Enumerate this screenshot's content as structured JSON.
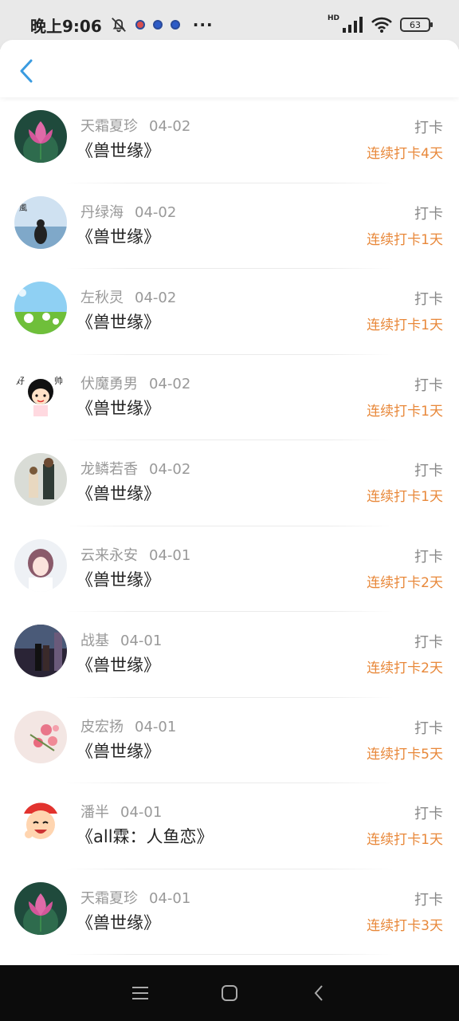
{
  "status_bar": {
    "time": "晚上9:06",
    "more": "···",
    "hd": "HD",
    "battery": "63"
  },
  "header": {
    "back_icon": "chevron-left-icon",
    "accent_color": "#3a9be0"
  },
  "items": [
    {
      "user": "天霜夏珍",
      "date": "04-02",
      "book": "《兽世缘》",
      "action": "打卡",
      "streak": "连续打卡4天",
      "avatar": "lotus"
    },
    {
      "user": "丹绿海",
      "date": "04-02",
      "book": "《兽世缘》",
      "action": "打卡",
      "streak": "连续打卡1天",
      "avatar": "sea-girl"
    },
    {
      "user": "左秋灵",
      "date": "04-02",
      "book": "《兽世缘》",
      "action": "打卡",
      "streak": "连续打卡1天",
      "avatar": "meadow"
    },
    {
      "user": "伏魔勇男",
      "date": "04-02",
      "book": "《兽世缘》",
      "action": "打卡",
      "streak": "连续打卡1天",
      "avatar": "cartoon-girl"
    },
    {
      "user": "龙鳞若香",
      "date": "04-02",
      "book": "《兽世缘》",
      "action": "打卡",
      "streak": "连续打卡1天",
      "avatar": "couple"
    },
    {
      "user": "云来永安",
      "date": "04-01",
      "book": "《兽世缘》",
      "action": "打卡",
      "streak": "连续打卡2天",
      "avatar": "portrait"
    },
    {
      "user": "战基",
      "date": "04-01",
      "book": "《兽世缘》",
      "action": "打卡",
      "streak": "连续打卡2天",
      "avatar": "dark-couple"
    },
    {
      "user": "皮宏扬",
      "date": "04-01",
      "book": "《兽世缘》",
      "action": "打卡",
      "streak": "连续打卡5天",
      "avatar": "flowers"
    },
    {
      "user": "潘半",
      "date": "04-01",
      "book": "《all霖：人鱼恋》",
      "action": "打卡",
      "streak": "连续打卡1天",
      "avatar": "cartoon-boy"
    },
    {
      "user": "天霜夏珍",
      "date": "04-01",
      "book": "《兽世缘》",
      "action": "打卡",
      "streak": "连续打卡3天",
      "avatar": "lotus"
    }
  ],
  "colors": {
    "streak": "#e8883a",
    "muted": "#999999",
    "title": "#222222"
  },
  "nav_bar": {
    "items": [
      "menu-icon",
      "home-icon",
      "back-icon"
    ]
  }
}
